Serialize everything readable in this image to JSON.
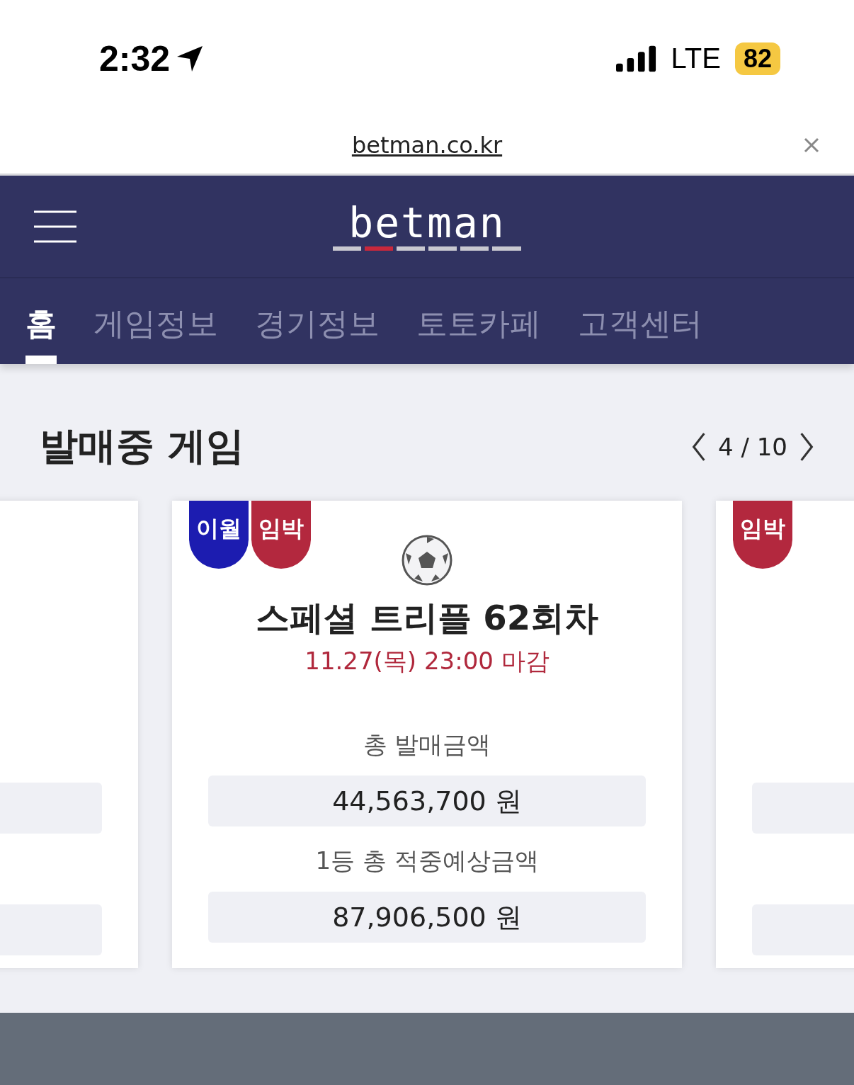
{
  "status_bar": {
    "time": "2:32",
    "network": "LTE",
    "battery": "82"
  },
  "browser": {
    "url": "betman.co.kr"
  },
  "header": {
    "logo": "betman"
  },
  "tabs": [
    {
      "label": "홈",
      "selected": true
    },
    {
      "label": "게임정보",
      "selected": false
    },
    {
      "label": "경기정보",
      "selected": false
    },
    {
      "label": "토토카페",
      "selected": false
    },
    {
      "label": "고객센터",
      "selected": false
    }
  ],
  "section": {
    "title": "발매중 게임",
    "pager": "4 / 10"
  },
  "games": [
    {
      "kind": "left_edge"
    },
    {
      "kind": "full",
      "badges": [
        {
          "label": "이월",
          "color": "#1c1cb0"
        },
        {
          "label": "임박",
          "color": "#b3283e"
        }
      ],
      "title": "스페셜 트리플 62회차",
      "deadline": "11.27(목) 23:00 마감",
      "total_label": "총 발매금액",
      "total": "44,563,700 원",
      "prize_label": "1등 총 적중예상금액",
      "prize": "87,906,500 원"
    },
    {
      "kind": "right_edge",
      "badges": [
        {
          "label": "임박",
          "color": "#b3283e"
        }
      ]
    }
  ]
}
